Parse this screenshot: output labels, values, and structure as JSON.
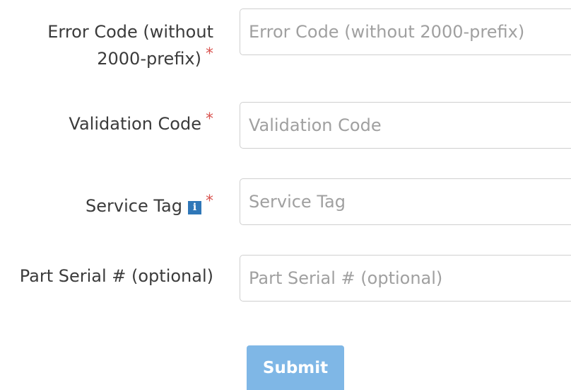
{
  "form": {
    "fields": [
      {
        "label_line1": "Error Code (without",
        "label_line2": "2000-prefix)",
        "required_mark": "*",
        "placeholder": "Error Code (without 2000-prefix)",
        "value": ""
      },
      {
        "label": "Validation Code",
        "required_mark": "*",
        "placeholder": "Validation Code",
        "value": ""
      },
      {
        "label": "Service Tag",
        "info_icon_glyph": "i",
        "icon": "info-icon",
        "required_mark": "*",
        "placeholder": "Service Tag",
        "value": ""
      },
      {
        "label": "Part Serial # (optional)",
        "placeholder": "Part Serial # (optional)",
        "value": ""
      }
    ],
    "submit_label": "Submit"
  },
  "colors": {
    "required": "#d9534f",
    "info_icon": "#2f77b8",
    "submit_bg": "#7fb7e6",
    "input_border": "#cfcfcf",
    "placeholder": "#a0a0a0",
    "label_text": "#3b3b3b"
  }
}
